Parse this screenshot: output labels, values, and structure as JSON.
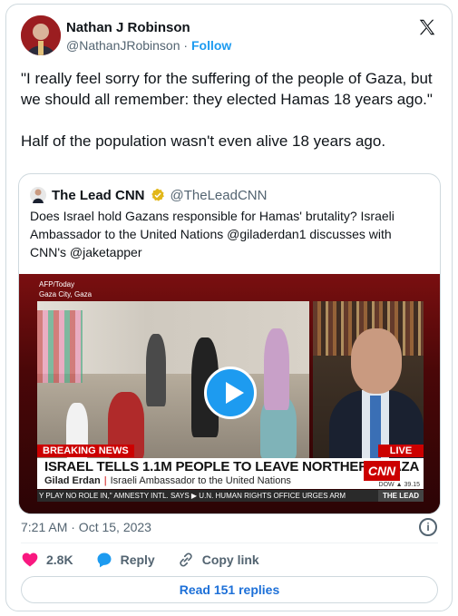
{
  "author": {
    "name": "Nathan J Robinson",
    "handle": "@NathanJRobinson",
    "follow_label": "Follow"
  },
  "tweet": {
    "paragraph1": "\"I really feel sorry for the suffering of the people of Gaza, but we should all remember: they elected Hamas 18 years ago.\"",
    "paragraph2": "Half of the population wasn't even alive 18 years ago."
  },
  "quote": {
    "name": "The Lead CNN",
    "handle": "@TheLeadCNN",
    "text": "Does Israel hold Gazans responsible for Hamas' brutality? Israeli Ambassador to the United Nations @giladerdan1 discusses with CNN's @jaketapper",
    "video": {
      "source_line1": "AFP/Today",
      "source_line2": "Gaza City, Gaza",
      "breaking": "BREAKING NEWS",
      "live": "LIVE",
      "headline": "ISRAEL TELLS 1.1M PEOPLE TO LEAVE NORTHERN GAZA",
      "guest_name": "Gilad Erdan",
      "guest_title": "Israeli Ambassador to the United Nations",
      "network_logo": "CNN",
      "dow": "DOW ▲ 39.15",
      "ticker": "Y PLAY NO ROLE IN,\" AMNESTY INTL. SAYS   ▶ U.N. HUMAN RIGHTS OFFICE URGES ARM",
      "show_tag": "THE LEAD"
    }
  },
  "meta": {
    "timestamp": "7:21 AM · Oct 15, 2023",
    "info_icon": "i"
  },
  "actions": {
    "likes": "2.8K",
    "reply_label": "Reply",
    "copy_label": "Copy link"
  },
  "replies_button": "Read 151 replies",
  "colors": {
    "accent": "#1d9bf0",
    "like": "#f91880",
    "cnn_red": "#cc0000"
  },
  "icons": [
    "x-logo-icon",
    "verified-badge-icon",
    "play-icon",
    "info-icon",
    "heart-icon",
    "reply-bubble-icon",
    "link-icon"
  ]
}
